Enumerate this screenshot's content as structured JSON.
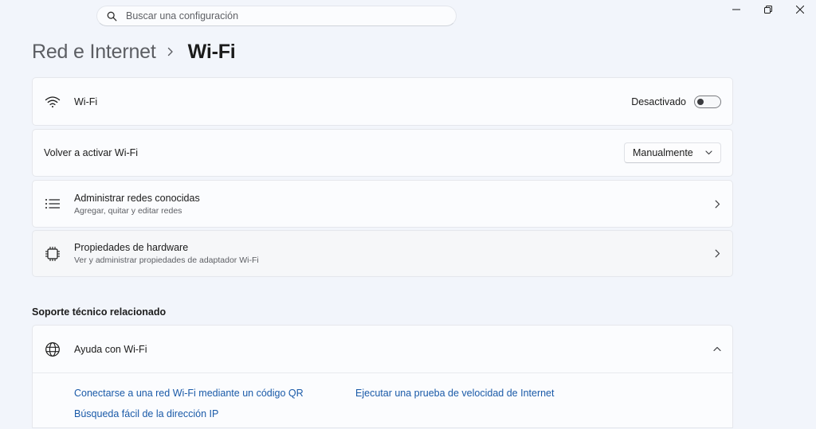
{
  "search": {
    "placeholder": "Buscar una configuración"
  },
  "breadcrumb": {
    "parent": "Red e Internet",
    "current": "Wi-Fi"
  },
  "wifi_row": {
    "title": "Wi-Fi",
    "state_label": "Desactivado",
    "toggle_on": false
  },
  "reactivate_row": {
    "title": "Volver a activar Wi-Fi",
    "selected": "Manualmente"
  },
  "known_networks_row": {
    "title": "Administrar redes conocidas",
    "subtitle": "Agregar, quitar y editar redes"
  },
  "hardware_row": {
    "title": "Propiedades de hardware",
    "subtitle": "Ver y administrar propiedades de adaptador Wi-Fi"
  },
  "support": {
    "section_title": "Soporte técnico relacionado",
    "help_title": "Ayuda con Wi-Fi",
    "links": [
      "Conectarse a una red Wi-Fi mediante un código QR",
      "Ejecutar una prueba de velocidad de Internet",
      "Búsqueda fácil de la dirección IP"
    ]
  },
  "colors": {
    "background": "#f2f5fb",
    "card": "#fbfcfe",
    "link": "#1a5aa8"
  },
  "icons": {
    "search": "search-icon",
    "minimize": "minimize-icon",
    "restore": "restore-icon",
    "close": "close-icon",
    "wifi": "wifi-icon",
    "list": "list-icon",
    "chip": "chip-icon",
    "globe": "globe-icon"
  }
}
